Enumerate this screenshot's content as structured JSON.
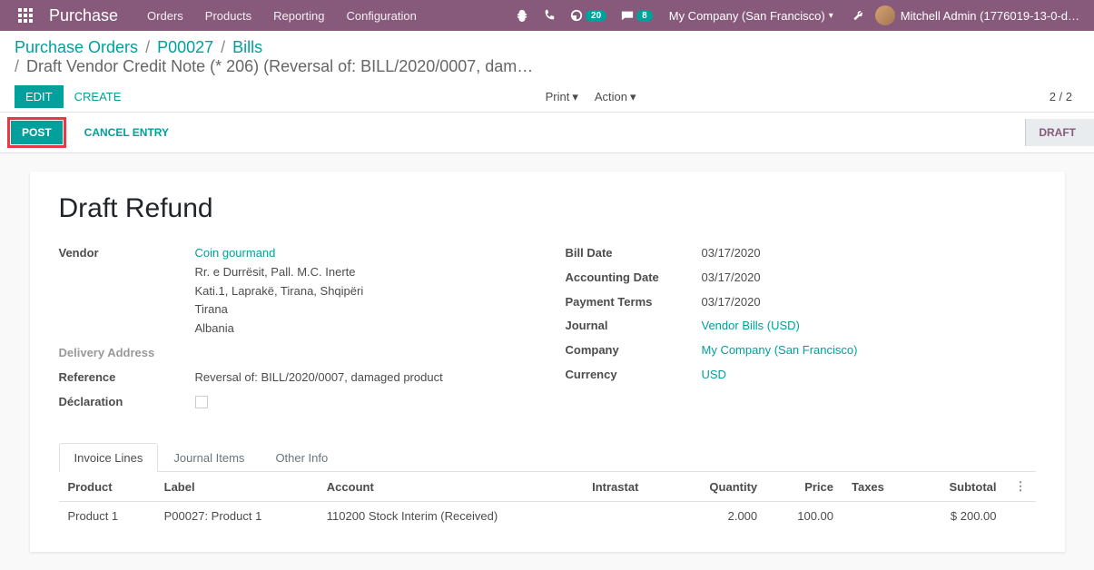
{
  "navbar": {
    "brand": "Purchase",
    "items": [
      "Orders",
      "Products",
      "Reporting",
      "Configuration"
    ],
    "activity_count": "20",
    "messages_count": "8",
    "company": "My Company (San Francisco)",
    "user": "Mitchell Admin (1776019-13-0-d…"
  },
  "breadcrumb": {
    "level1": "Purchase Orders",
    "level2": "P00027",
    "level3": "Bills",
    "current": "Draft Vendor Credit Note (* 206) (Reversal of: BILL/2020/0007, dam…"
  },
  "actions": {
    "edit": "Edit",
    "create": "Create",
    "print": "Print",
    "action": "Action",
    "pager": "2 / 2"
  },
  "statusbar": {
    "post": "Post",
    "cancel": "Cancel Entry",
    "stage": "Draft"
  },
  "form": {
    "title": "Draft Refund",
    "left": {
      "vendor_label": "Vendor",
      "vendor_name": "Coin gourmand",
      "vendor_addr1": "Rr. e Durrësit, Pall. M.C. Inerte",
      "vendor_addr2": "Kati.1, Laprakë, Tirana, Shqipëri",
      "vendor_city": "Tirana",
      "vendor_country": "Albania",
      "delivery_label": "Delivery Address",
      "reference_label": "Reference",
      "reference_value": "Reversal of: BILL/2020/0007, damaged product",
      "declaration_label": "Déclaration"
    },
    "right": {
      "bill_date_label": "Bill Date",
      "bill_date": "03/17/2020",
      "acct_date_label": "Accounting Date",
      "acct_date": "03/17/2020",
      "payment_terms_label": "Payment Terms",
      "payment_terms": "03/17/2020",
      "journal_label": "Journal",
      "journal": "Vendor Bills (USD)",
      "company_label": "Company",
      "company": "My Company (San Francisco)",
      "currency_label": "Currency",
      "currency": "USD"
    }
  },
  "tabs": {
    "invoice_lines": "Invoice Lines",
    "journal_items": "Journal Items",
    "other_info": "Other Info"
  },
  "table": {
    "headers": {
      "product": "Product",
      "label": "Label",
      "account": "Account",
      "intrastat": "Intrastat",
      "quantity": "Quantity",
      "price": "Price",
      "taxes": "Taxes",
      "subtotal": "Subtotal"
    },
    "rows": [
      {
        "product": "Product 1",
        "label": "P00027: Product 1",
        "account": "110200 Stock Interim (Received)",
        "intrastat": "",
        "quantity": "2.000",
        "price": "100.00",
        "taxes": "",
        "subtotal": "$ 200.00"
      }
    ]
  }
}
